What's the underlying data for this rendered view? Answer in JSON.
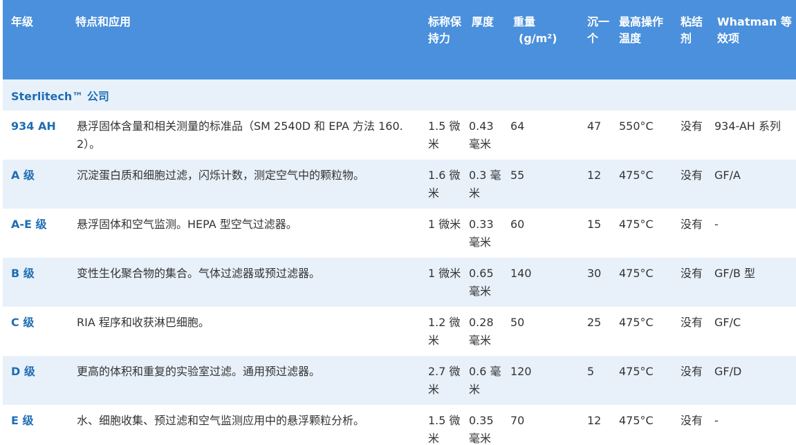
{
  "headers": {
    "grade": "年级",
    "features": "特点和应用",
    "retention": "标称保持力",
    "thickness": "厚度",
    "weight": "重量",
    "weight_unit": "(g/m²)",
    "flow": "沉一个",
    "max_temp": "最高操作温度",
    "binder": "粘结剂",
    "whatman": "Whatman 等效项"
  },
  "company": "Sterlitech™ 公司",
  "rows": [
    {
      "grade": "934 AH",
      "features": "悬浮固体含量和相关测量的标准品（SM 2540D 和 EPA 方法 160.2）。",
      "retention": "1.5 微米",
      "thickness": "0.43 毫米",
      "weight": "64",
      "flow": "47",
      "temp": "550°C",
      "binder": "没有",
      "whatman": "934-AH 系列"
    },
    {
      "grade": "A 级",
      "features": "沉淀蛋白质和细胞过滤，闪烁计数，测定空气中的颗粒物。",
      "retention": "1.6 微米",
      "thickness": "0.3 毫米",
      "weight": "55",
      "flow": "12",
      "temp": "475°C",
      "binder": "没有",
      "whatman": "GF/A"
    },
    {
      "grade": "A-E 级",
      "features": "悬浮固体和空气监测。HEPA 型空气过滤器。",
      "retention": "1 微米",
      "thickness": "0.33 毫米",
      "weight": "60",
      "flow": "15",
      "temp": "475°C",
      "binder": "没有",
      "whatman": "-"
    },
    {
      "grade": "B 级",
      "features": "变性生化聚合物的集合。气体过滤器或预过滤器。",
      "retention": "1 微米",
      "thickness": "0.65 毫米",
      "weight": "140",
      "flow": "30",
      "temp": "475°C",
      "binder": "没有",
      "whatman": "GF/B 型"
    },
    {
      "grade": "C 级",
      "features": "RIA 程序和收获淋巴细胞。",
      "retention": "1.2 微米",
      "thickness": "0.28 毫米",
      "weight": "50",
      "flow": "25",
      "temp": "475°C",
      "binder": "没有",
      "whatman": "GF/C"
    },
    {
      "grade": "D 级",
      "features": "更高的体积和重复的实验室过滤。通用预过滤器。",
      "retention": "2.7 微米",
      "thickness": "0.6 毫米",
      "weight": "120",
      "flow": "5",
      "temp": "475°C",
      "binder": "没有",
      "whatman": "GF/D"
    },
    {
      "grade": "E 级",
      "features": "水、细胞收集、预过滤和空气监测应用中的悬浮颗粒分析。",
      "retention": "1.5 微米",
      "thickness": "0.35 毫米",
      "weight": "70",
      "flow": "12",
      "temp": "475°C",
      "binder": "没有",
      "whatman": "-"
    }
  ],
  "colors": {
    "header_bg": "#4a90dc",
    "stripe_bg": "#e8f1fa",
    "link_blue": "#1f6db4",
    "body_text": "#333333"
  }
}
